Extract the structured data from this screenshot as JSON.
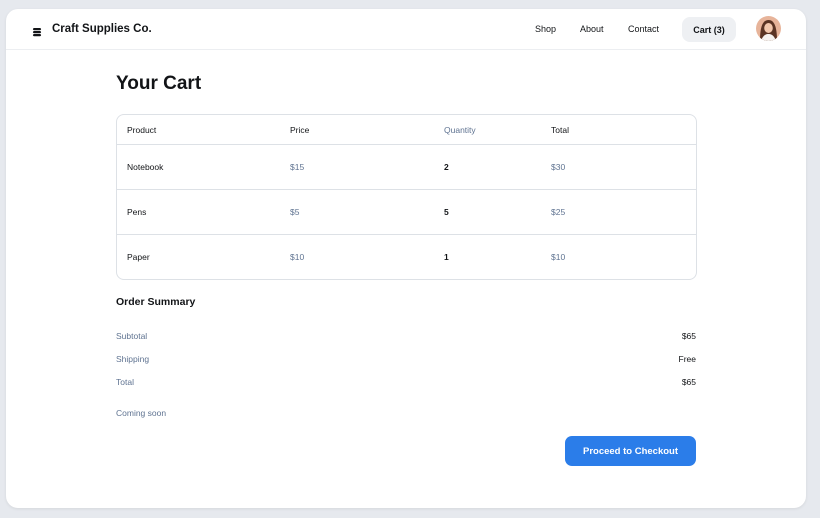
{
  "brand": {
    "name": "Craft Supplies Co.",
    "icon": "stack-icon"
  },
  "nav": {
    "links": [
      "Shop",
      "About",
      "Contact"
    ],
    "cart_label": "Cart (3)"
  },
  "page": {
    "title": "Your Cart"
  },
  "table": {
    "headers": [
      "Product",
      "Price",
      "Quantity",
      "Total"
    ],
    "rows": [
      {
        "product": "Notebook",
        "price": "$15",
        "quantity": "2",
        "total": "$30"
      },
      {
        "product": "Pens",
        "price": "$5",
        "quantity": "5",
        "total": "$25"
      },
      {
        "product": "Paper",
        "price": "$10",
        "quantity": "1",
        "total": "$10"
      }
    ]
  },
  "summary": {
    "title": "Order Summary",
    "rows": [
      {
        "label": "Subtotal",
        "value": "$65"
      },
      {
        "label": "Shipping",
        "value": "Free"
      },
      {
        "label": "Total",
        "value": "$65"
      }
    ],
    "note": "Coming soon"
  },
  "checkout": {
    "label": "Proceed to Checkout"
  },
  "colors": {
    "accent": "#2b7de9",
    "muted_text": "#5f7391",
    "border": "#dde1e6",
    "background": "#e6e9ee"
  }
}
